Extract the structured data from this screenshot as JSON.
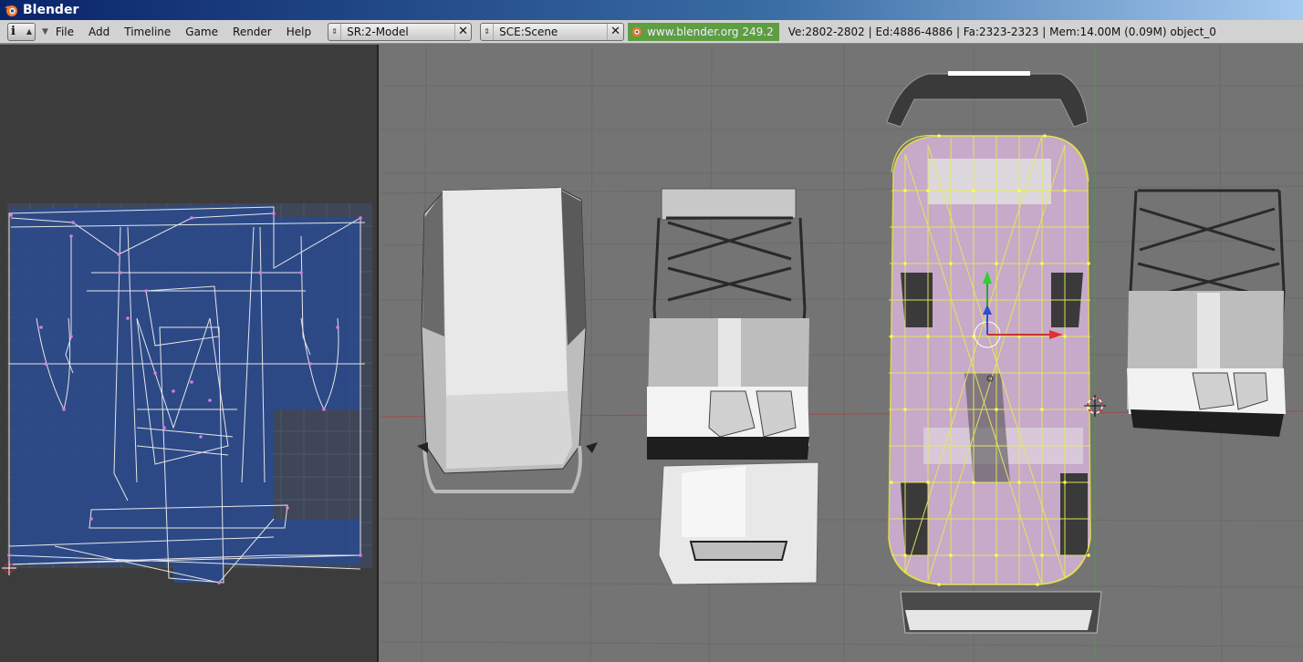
{
  "window": {
    "title": "Blender",
    "logo_icon": "blender-logo-icon"
  },
  "header": {
    "window_type_icon": "info-icon",
    "window_type_glyph": "i",
    "menu": [
      "File",
      "Add",
      "Timeline",
      "Game",
      "Render",
      "Help"
    ],
    "screen_selector": {
      "value": "SR:2-Model",
      "icon": "updown-arrows-icon",
      "close_icon": "close-icon"
    },
    "scene_selector": {
      "value": "SCE:Scene",
      "icon": "updown-arrows-icon",
      "close_icon": "close-icon"
    },
    "url": "www.blender.org 249.2",
    "stats": "Ve:2802-2802 | Ed:4886-4886 | Fa:2323-2323 | Mem:14.00M (0.09M) object_0"
  },
  "colors": {
    "titlebar_start": "#0a246a",
    "header_bg": "#d2d2d2",
    "uv_bg": "#3c3c3c",
    "uv_image": "#2a3d6e",
    "uv_wire": "#e8e8e8",
    "uv_vertex": "#e07ae0",
    "viewport_bg": "#747474",
    "grid_line": "#6a6a6a",
    "x_axis": "#a04a4a",
    "y_axis": "#4a9a4a",
    "selection_wire": "#e8e85a",
    "selected_face": "#c7a9c9",
    "url_badge": "#5f9d43"
  },
  "viewport": {
    "objects": [
      "roof-panel",
      "rollcage-with-hood",
      "selected-body",
      "rollcage-rear"
    ],
    "widgets": [
      "transform-manipulator-icon",
      "3d-cursor-icon"
    ]
  }
}
